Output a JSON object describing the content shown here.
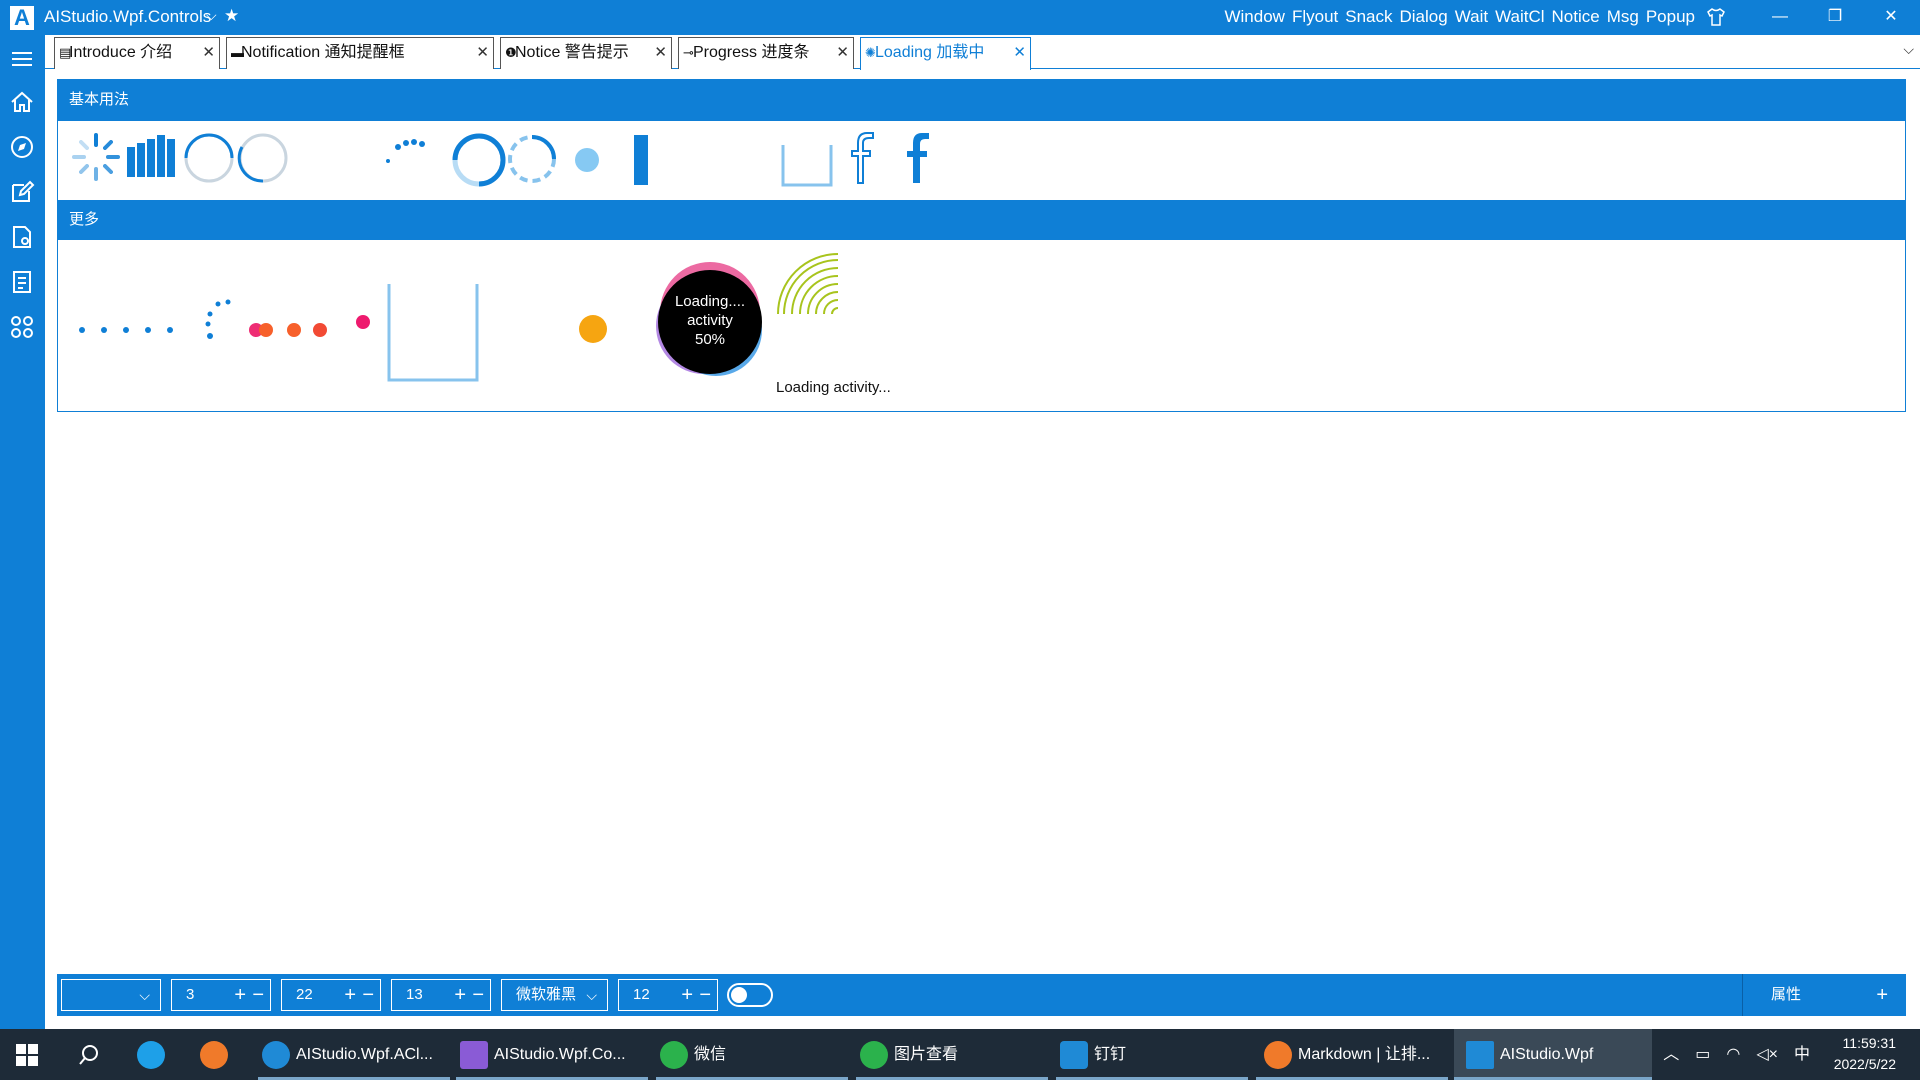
{
  "window": {
    "title": "AIStudio.Wpf.Controls",
    "menu": [
      "Window",
      "Flyout",
      "Snack",
      "Dialog",
      "Wait",
      "WaitCl",
      "Notice",
      "Msg",
      "Popup"
    ]
  },
  "tabs": [
    {
      "icon": "document-icon",
      "label": "Introduce 介绍"
    },
    {
      "icon": "keyboard-icon",
      "label": "Notification 通知提醒框"
    },
    {
      "icon": "warning-icon",
      "label": "Notice 警告提示"
    },
    {
      "icon": "progress-icon",
      "label": "Progress 进度条"
    },
    {
      "icon": "loading-icon",
      "label": "Loading 加载中",
      "active": true
    }
  ],
  "sections": {
    "basic": "基本用法",
    "more": "更多"
  },
  "loaders": {
    "activity_text": "Loading.... activity 50%",
    "activity_line1": "Loading....",
    "activity_line2": "activity",
    "activity_line3": "50%",
    "wave_caption": "Loading activity..."
  },
  "toolbar": {
    "field2": "3",
    "field3": "22",
    "field4": "13",
    "font": "微软雅黑",
    "field6": "12",
    "properties_label": "属性"
  },
  "taskbar": {
    "items": [
      {
        "label": "AIStudio.Wpf.ACl...",
        "color": "#1f8ad6"
      },
      {
        "label": "AIStudio.Wpf.Co...",
        "color": "#8a5bd6"
      },
      {
        "label": "微信",
        "color": "#2bb24c"
      },
      {
        "label": "图片查看",
        "color": "#2bb24c"
      },
      {
        "label": "钉钉",
        "color": "#1f8ad6"
      },
      {
        "label": "Markdown | 让排...",
        "color": "#f07a2a"
      },
      {
        "label": "AIStudio.Wpf",
        "color": "#1f8ad6"
      }
    ],
    "ime": "中",
    "time": "11:59:31",
    "date": "2022/5/22"
  },
  "colors": {
    "accent": "#0f7fd6",
    "taskbar": "#1e2b38"
  }
}
